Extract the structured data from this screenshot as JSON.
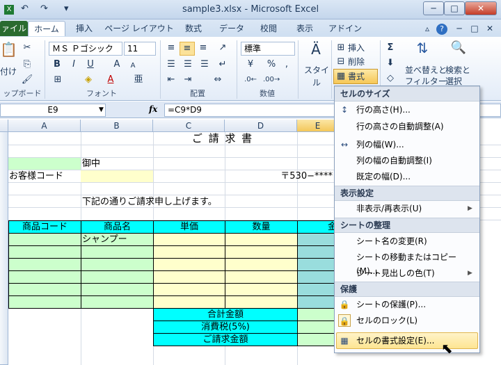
{
  "window": {
    "title": "sample3.xlsx - Microsoft Excel",
    "min": "─",
    "max": "□",
    "close": "✕"
  },
  "qat": {
    "save": "💾",
    "undo": "↶",
    "redo": "↷",
    "customize": "▾"
  },
  "tabs": [
    "ァイル",
    "ホーム",
    "挿入",
    "ページ レイアウト",
    "数式",
    "データ",
    "校閲",
    "表示",
    "アドイン"
  ],
  "ribbon_right_icons": {
    "minimize": "▵",
    "help": "?",
    "doc_min": "─",
    "doc_max": "□",
    "doc_close": "✕"
  },
  "ribbon": {
    "clipboard": {
      "paste_label": "付け",
      "group": "ップボード"
    },
    "font": {
      "name": "ＭＳ Ｐゴシック",
      "size": "11",
      "bold": "B",
      "italic": "I",
      "underline": "U",
      "grow": "A",
      "shrink": "A",
      "phonetic": "亜",
      "group": "フォント"
    },
    "alignment": {
      "group": "配置"
    },
    "number": {
      "format": "標準",
      "percent": "%",
      "comma": ",",
      "group": "数値"
    },
    "styles": {
      "label": "スタイル"
    },
    "cells": {
      "insert": "挿入",
      "delete": "削除",
      "format": "書式"
    },
    "editing": {
      "sum": "Σ",
      "sort": "並べ替えと",
      "filter": "フィルター",
      "find": "検索と",
      "select": "選択"
    }
  },
  "formula_bar": {
    "name_box": "E9",
    "fx": "fx",
    "formula": "=C9*D9"
  },
  "columns": [
    "A",
    "B",
    "C",
    "D",
    "E"
  ],
  "sheet": {
    "title": "ご 請 求 書",
    "onchu": "御中",
    "customer_code_label": "お客様コード",
    "postal": "〒530−****",
    "intro": "下記の通りご請求申し上げます。",
    "headers": [
      "商品コード",
      "商品名",
      "単価",
      "数量",
      "金"
    ],
    "row1_name": "シャンプー",
    "total": "合計金額",
    "tax": "消費税(5%)",
    "grand_total": "ご請求金額"
  },
  "menu": {
    "section_size": "セルのサイズ",
    "row_height": "行の高さ(H)...",
    "row_autofit": "行の高さの自動調整(A)",
    "col_width": "列の幅(W)...",
    "col_autofit": "列の幅の自動調整(I)",
    "default_width": "既定の幅(D)...",
    "section_visibility": "表示設定",
    "hide_unhide": "非表示/再表示(U)",
    "section_organize": "シートの整理",
    "rename": "シート名の変更(R)",
    "move_copy": "シートの移動またはコピー(M)...",
    "tab_color": "シート見出しの色(T)",
    "section_protect": "保護",
    "protect_sheet": "シートの保護(P)...",
    "lock_cell": "セルのロック(L)",
    "format_cells": "セルの書式設定(E)..."
  }
}
